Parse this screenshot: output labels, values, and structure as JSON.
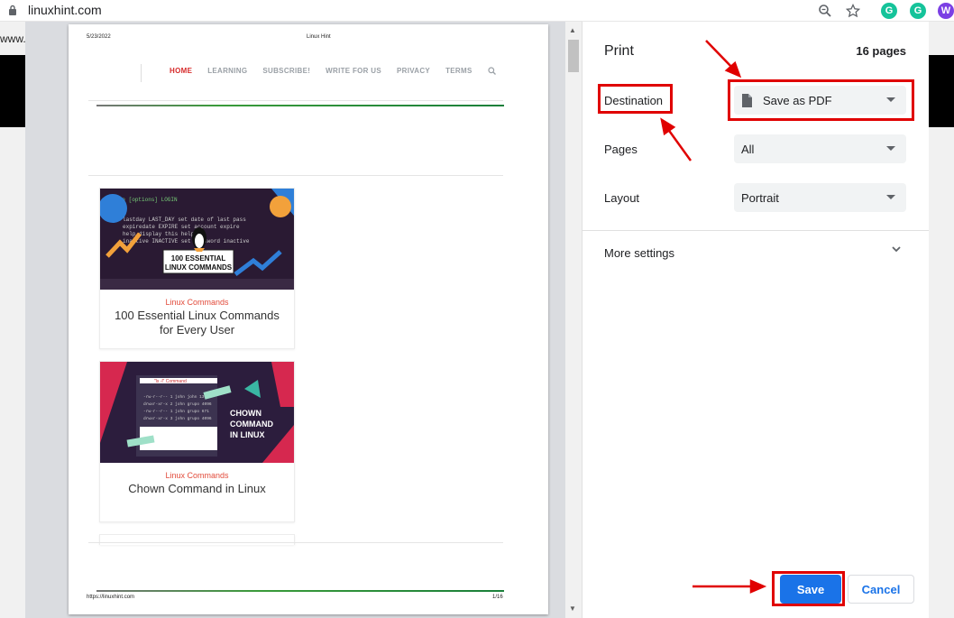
{
  "browser": {
    "url": "linuxhint.com",
    "bg_url_fragment": "www.g"
  },
  "preview": {
    "date": "5/23/2022",
    "site_title": "Linux Hint",
    "nav": [
      "HOME",
      "LEARNING",
      "SUBSCRIBE!",
      "WRITE FOR US",
      "PRIVACY",
      "TERMS"
    ],
    "active_nav": "HOME",
    "cards": [
      {
        "category": "Linux Commands",
        "title": "100 Essential Linux Commands for Every User",
        "image_text": "100 ESSENTIAL LINUX COMMANDS"
      },
      {
        "category": "Linux Commands",
        "title": "Chown Command in Linux",
        "image_text": "CHOWN COMMAND IN LINUX"
      }
    ],
    "footer_url": "https://linuxhint.com",
    "footer_page": "1/16"
  },
  "print_panel": {
    "title": "Print",
    "page_count": "16 pages",
    "destination_label": "Destination",
    "destination_value": "Save as PDF",
    "pages_label": "Pages",
    "pages_value": "All",
    "layout_label": "Layout",
    "layout_value": "Portrait",
    "more_settings": "More settings",
    "save_label": "Save",
    "cancel_label": "Cancel"
  },
  "colors": {
    "accent": "#1a73e8",
    "annotation": "#e00000"
  }
}
